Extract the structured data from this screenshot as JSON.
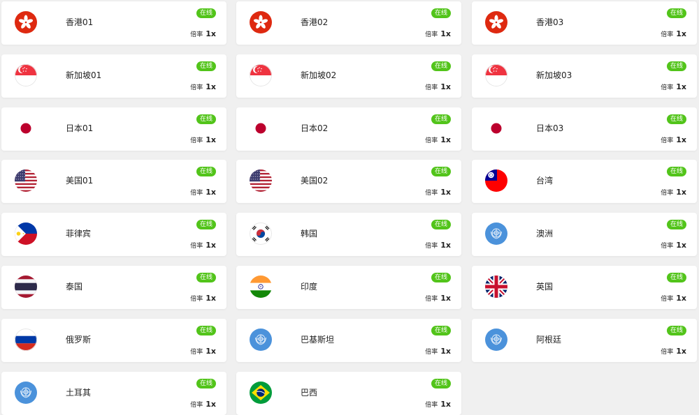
{
  "status_label": "在线",
  "rate_label": "倍率",
  "colors": {
    "online_badge": "#52c41a",
    "card_background": "#ffffff",
    "page_background": "#f0f0f0"
  },
  "servers": [
    {
      "name": "香港01",
      "flag": "hong-kong",
      "rate": "1x"
    },
    {
      "name": "香港02",
      "flag": "hong-kong",
      "rate": "1x"
    },
    {
      "name": "香港03",
      "flag": "hong-kong",
      "rate": "1x"
    },
    {
      "name": "新加坡01",
      "flag": "singapore",
      "rate": "1x"
    },
    {
      "name": "新加坡02",
      "flag": "singapore",
      "rate": "1x"
    },
    {
      "name": "新加坡03",
      "flag": "singapore",
      "rate": "1x"
    },
    {
      "name": "日本01",
      "flag": "japan",
      "rate": "1x"
    },
    {
      "name": "日本02",
      "flag": "japan",
      "rate": "1x"
    },
    {
      "name": "日本03",
      "flag": "japan",
      "rate": "1x"
    },
    {
      "name": "美国01",
      "flag": "usa",
      "rate": "1x"
    },
    {
      "name": "美国02",
      "flag": "usa",
      "rate": "1x"
    },
    {
      "name": "台湾",
      "flag": "taiwan",
      "rate": "1x"
    },
    {
      "name": "菲律宾",
      "flag": "philippines",
      "rate": "1x"
    },
    {
      "name": "韩国",
      "flag": "south-korea",
      "rate": "1x"
    },
    {
      "name": "澳洲",
      "flag": "united-nations",
      "rate": "1x"
    },
    {
      "name": "泰国",
      "flag": "thailand",
      "rate": "1x"
    },
    {
      "name": "印度",
      "flag": "india",
      "rate": "1x"
    },
    {
      "name": "英国",
      "flag": "uk",
      "rate": "1x"
    },
    {
      "name": "俄罗斯",
      "flag": "russia",
      "rate": "1x"
    },
    {
      "name": "巴基斯坦",
      "flag": "united-nations",
      "rate": "1x"
    },
    {
      "name": "阿根廷",
      "flag": "united-nations",
      "rate": "1x"
    },
    {
      "name": "土耳其",
      "flag": "united-nations",
      "rate": "1x"
    },
    {
      "name": "巴西",
      "flag": "brazil",
      "rate": "1x"
    }
  ]
}
